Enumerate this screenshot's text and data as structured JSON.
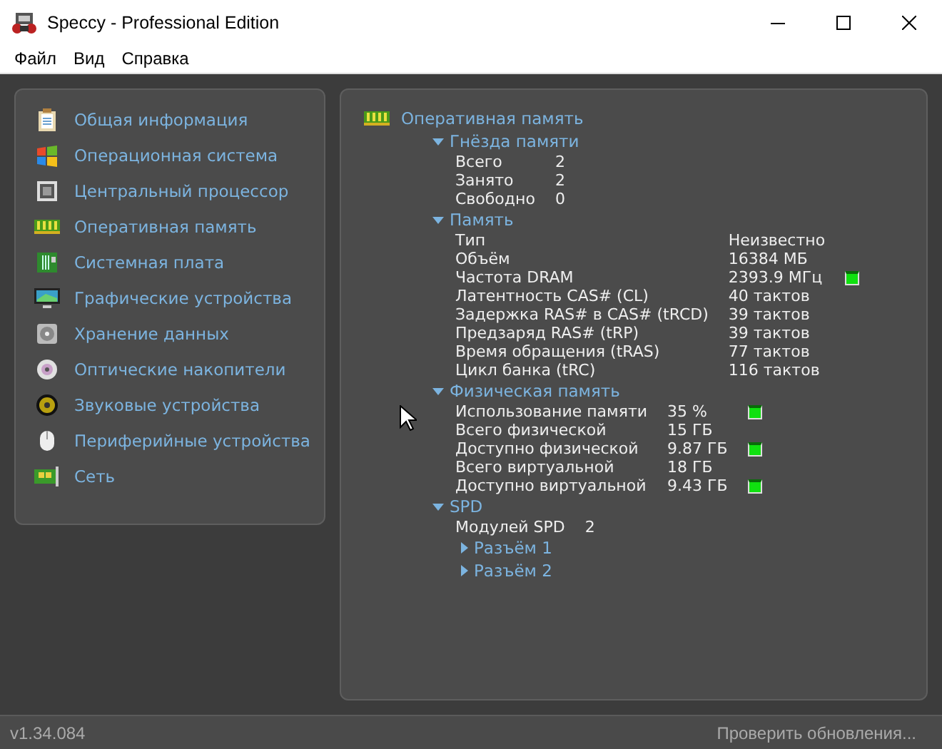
{
  "window": {
    "title": "Speccy - Professional Edition"
  },
  "menu": [
    "Файл",
    "Вид",
    "Справка"
  ],
  "sidebar": {
    "items": [
      {
        "label": "Общая информация"
      },
      {
        "label": "Операционная система"
      },
      {
        "label": "Центральный процессор"
      },
      {
        "label": "Оперативная память"
      },
      {
        "label": "Системная плата"
      },
      {
        "label": "Графические устройства"
      },
      {
        "label": "Хранение данных"
      },
      {
        "label": "Оптические накопители"
      },
      {
        "label": "Звуковые устройства"
      },
      {
        "label": "Периферийные устройства"
      },
      {
        "label": "Сеть"
      }
    ]
  },
  "details": {
    "title": "Оперативная память",
    "sections": [
      {
        "title": "Гнёзда памяти",
        "expanded": true,
        "rows": [
          {
            "label": "Всего",
            "value": "2"
          },
          {
            "label": "Занято",
            "value": "2"
          },
          {
            "label": "Свободно",
            "value": "0"
          }
        ]
      },
      {
        "title": "Память",
        "expanded": true,
        "rows": [
          {
            "label": "Тип",
            "value": "Неизвестно"
          },
          {
            "label": "Объём",
            "value": "16384 МБ"
          },
          {
            "label": "Частота DRAM",
            "value": "2393.9 МГц",
            "indicator": true
          },
          {
            "label": "Латентность CAS# (CL)",
            "value": "40 тактов"
          },
          {
            "label": "Задержка RAS# в CAS# (tRCD)",
            "value": "39 тактов"
          },
          {
            "label": "Предзаряд RAS# (tRP)",
            "value": "39 тактов"
          },
          {
            "label": "Время обращения (tRAS)",
            "value": "77 тактов"
          },
          {
            "label": "Цикл банка (tRC)",
            "value": "116 тактов"
          }
        ]
      },
      {
        "title": "Физическая память",
        "expanded": true,
        "rows": [
          {
            "label": "Использование памяти",
            "value": "35 %",
            "indicator": true
          },
          {
            "label": "Всего физической",
            "value": "15 ГБ"
          },
          {
            "label": "Доступно физической",
            "value": "9.87 ГБ",
            "indicator": true
          },
          {
            "label": "Всего виртуальной",
            "value": "18 ГБ"
          },
          {
            "label": "Доступно виртуальной",
            "value": "9.43 ГБ",
            "indicator": true
          }
        ]
      },
      {
        "title": "SPD",
        "expanded": true,
        "rows": [
          {
            "label": "Модулей SPD",
            "value": "2"
          }
        ],
        "children": [
          {
            "title": "Разъём 1",
            "expanded": false
          },
          {
            "title": "Разъём 2",
            "expanded": false
          }
        ]
      }
    ]
  },
  "status_bar": {
    "version": "v1.34.084",
    "update_link": "Проверить обновления..."
  }
}
